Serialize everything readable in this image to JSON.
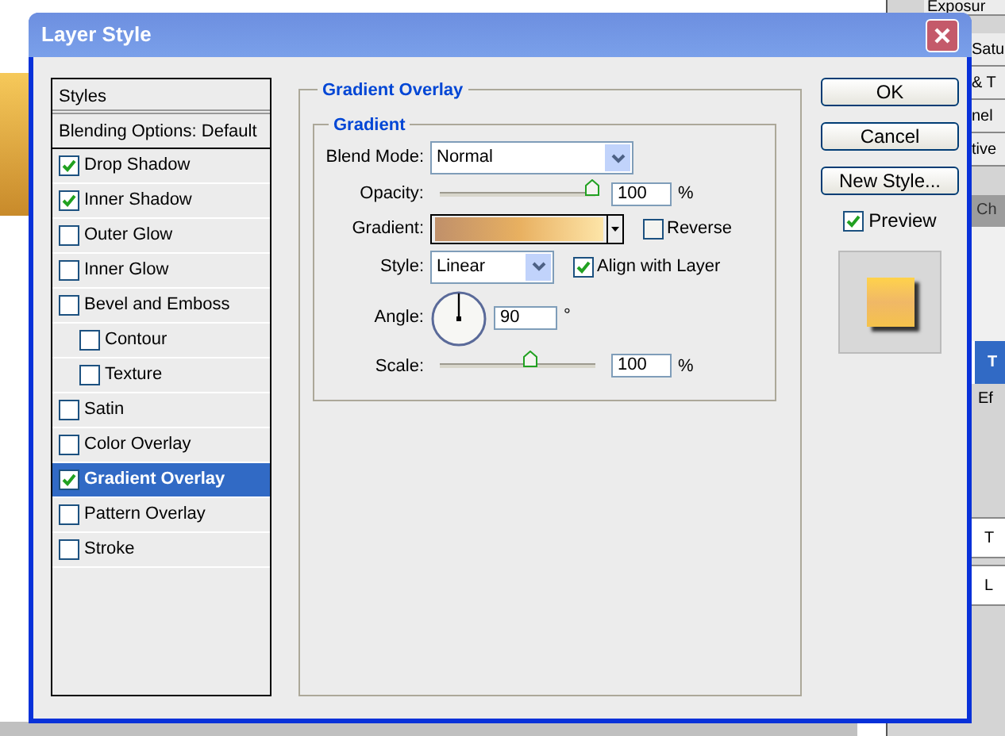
{
  "background": {
    "panel_labels": [
      "Exposur",
      "Satu",
      "& T",
      "nel",
      "tive"
    ],
    "tab_label": "Ch",
    "effects_label": "Ef",
    "layer_labels": [
      "T",
      "T",
      "L"
    ]
  },
  "window": {
    "title": "Layer Style"
  },
  "styles_list": {
    "header": "Styles",
    "blending": "Blending Options: Default",
    "items": [
      {
        "label": "Drop Shadow",
        "checked": true,
        "selected": false
      },
      {
        "label": "Inner Shadow",
        "checked": true,
        "selected": false
      },
      {
        "label": "Outer Glow",
        "checked": false,
        "selected": false
      },
      {
        "label": "Inner Glow",
        "checked": false,
        "selected": false
      },
      {
        "label": "Bevel and Emboss",
        "checked": false,
        "selected": false,
        "children": [
          {
            "label": "Contour",
            "checked": false,
            "selected": false
          },
          {
            "label": "Texture",
            "checked": false,
            "selected": false
          }
        ]
      },
      {
        "label": "Satin",
        "checked": false,
        "selected": false
      },
      {
        "label": "Color Overlay",
        "checked": false,
        "selected": false
      },
      {
        "label": "Gradient Overlay",
        "checked": true,
        "selected": true
      },
      {
        "label": "Pattern Overlay",
        "checked": false,
        "selected": false
      },
      {
        "label": "Stroke",
        "checked": false,
        "selected": false
      }
    ]
  },
  "section": {
    "title": "Gradient Overlay",
    "group": "Gradient",
    "blend_mode": {
      "label": "Blend Mode:",
      "value": "Normal"
    },
    "opacity": {
      "label": "Opacity:",
      "level": 0.98,
      "value": "100",
      "unit": "%"
    },
    "gradient": {
      "label": "Gradient:"
    },
    "reverse": {
      "label": "Reverse",
      "checked": false
    },
    "style": {
      "label": "Style:",
      "value": "Linear"
    },
    "align": {
      "label": "Align with Layer",
      "checked": true
    },
    "angle": {
      "label": "Angle:",
      "value": "90",
      "unit": "°"
    },
    "scale": {
      "label": "Scale:",
      "level": 0.58,
      "value": "100",
      "unit": "%"
    }
  },
  "buttons": [
    "OK",
    "Cancel",
    "New Style..."
  ],
  "preview": {
    "label": "Preview",
    "checked": true
  }
}
